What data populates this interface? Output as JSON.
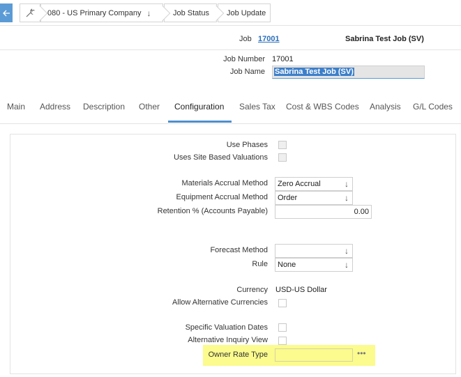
{
  "breadcrumb": {
    "back_icon": "arrow-left",
    "wrench_icon": "wrench",
    "company": "080 - US Primary Company",
    "company_dropdown_icon": "arrow-down",
    "status": "Job Status",
    "update": "Job Update"
  },
  "header": {
    "job_label": "Job",
    "job_number_link": "17001",
    "job_name_display": "Sabrina Test Job (SV)",
    "job_number_label": "Job Number",
    "job_number_value": "17001",
    "job_name_label": "Job Name",
    "job_name_value": "Sabrina Test Job (SV)"
  },
  "tabs": [
    "Main",
    "Address",
    "Description",
    "Other",
    "Configuration",
    "Sales Tax",
    "Cost & WBS Codes",
    "Analysis",
    "G/L Codes"
  ],
  "active_tab": "Configuration",
  "form": {
    "use_phases": "Use Phases",
    "site_valuations": "Uses Site Based Valuations",
    "materials_accrual_label": "Materials Accrual Method",
    "materials_accrual_value": "Zero Accrual",
    "equipment_accrual_label": "Equipment Accrual Method",
    "equipment_accrual_value": "Order",
    "retention_label": "Retention % (Accounts Payable)",
    "retention_value": "0.00",
    "forecast_label": "Forecast Method",
    "forecast_value": "",
    "rule_label": "Rule",
    "rule_value": "None",
    "currency_label": "Currency",
    "currency_value": "USD-US Dollar",
    "alt_currencies_label": "Allow Alternative Currencies",
    "specific_valuation_label": "Specific Valuation Dates",
    "alt_inquiry_label": "Alternative Inquiry View",
    "owner_rate_label": "Owner Rate Type",
    "owner_rate_value": "",
    "ellipsis": "•••"
  },
  "colors": {
    "accent": "#4d8fce",
    "highlight": "#fbfb8e",
    "link": "#2a6ebb"
  }
}
